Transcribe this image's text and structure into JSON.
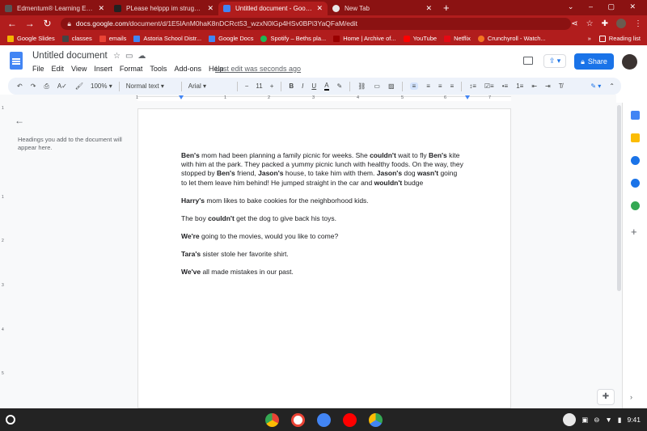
{
  "tabs": [
    {
      "title": "Edmentum® Learning Environme",
      "icon_color": "#555555"
    },
    {
      "title": "PLease helppp im struggling - Br",
      "icon_color": "#222222"
    },
    {
      "title": "Untitled document - Google Docs",
      "icon_color": "#4285f4",
      "active": true
    },
    {
      "title": "New Tab",
      "icon_color": "#e8e8e8"
    }
  ],
  "address": {
    "domain": "docs.google.com",
    "path": "/document/d/1E5lAnM0haK8nDCRct53_wzxN0lGp4HSv0BPi3YaQFaM/edit"
  },
  "bookmarks": [
    {
      "label": "Google Slides",
      "icon_color": "#f4b400"
    },
    {
      "label": "classes",
      "icon_color": "#444444"
    },
    {
      "label": "emails",
      "icon_color": "#ea4335"
    },
    {
      "label": "Astoria School Distr...",
      "icon_color": "#4285f4"
    },
    {
      "label": "Google Docs",
      "icon_color": "#4285f4"
    },
    {
      "label": "Spotify – Beths pla...",
      "icon_color": "#1db954"
    },
    {
      "label": "Home | Archive of...",
      "icon_color": "#990000"
    },
    {
      "label": "YouTube",
      "icon_color": "#ff0000"
    },
    {
      "label": "Netflix",
      "icon_color": "#e50914"
    },
    {
      "label": "Crunchyroll - Watch...",
      "icon_color": "#f47521"
    }
  ],
  "reading_list": "Reading list",
  "docs": {
    "title": "Untitled document",
    "menus": [
      "File",
      "Edit",
      "View",
      "Insert",
      "Format",
      "Tools",
      "Add-ons",
      "Help"
    ],
    "last_edit": "Last edit was seconds ago",
    "share_label": "Share"
  },
  "toolbar": {
    "zoom": "100%",
    "style": "Normal text",
    "font": "Arial",
    "size": "11"
  },
  "ruler_numbers": [
    "1",
    "1",
    "2",
    "3",
    "4",
    "5",
    "6",
    "7"
  ],
  "outline": {
    "hint": "Headings you add to the document will appear here."
  },
  "document": {
    "p1": [
      {
        "t": "Ben's",
        "b": true
      },
      {
        "t": " mom had been planning a family picnic for weeks. She "
      },
      {
        "t": "couldn't",
        "b": true
      },
      {
        "t": " wait to fly "
      },
      {
        "t": "Ben's",
        "b": true
      },
      {
        "t": " kite with him at the park. They packed a yummy picnic lunch with healthy foods. On the way, they stopped by "
      },
      {
        "t": "Ben's",
        "b": true
      },
      {
        "t": " friend, "
      },
      {
        "t": "Jason's",
        "b": true
      },
      {
        "t": " house, to take him with them. "
      },
      {
        "t": "Jason's",
        "b": true
      },
      {
        "t": " dog "
      },
      {
        "t": "wasn't",
        "b": true
      },
      {
        "t": " going to let them leave him behind! He jumped straight in the car and "
      },
      {
        "t": "wouldn't",
        "b": true
      },
      {
        "t": " budge"
      }
    ],
    "p2": [
      {
        "t": "Harry's",
        "b": true
      },
      {
        "t": " mom likes to bake cookies for the neighborhood kids."
      }
    ],
    "p3": [
      {
        "t": "The boy "
      },
      {
        "t": "couldn't",
        "b": true
      },
      {
        "t": " get the dog to give back his toys."
      }
    ],
    "p4": [
      {
        "t": "We're",
        "b": true
      },
      {
        "t": " going to the movies, would you like to come?"
      }
    ],
    "p5": [
      {
        "t": "Tara's",
        "b": true
      },
      {
        "t": " sister stole her favorite shirt."
      }
    ],
    "p6": [
      {
        "t": "We've",
        "b": true
      },
      {
        "t": " all made mistakes in our past."
      }
    ]
  },
  "shelf": {
    "time": "9:41",
    "apps": [
      {
        "name": "chrome-app",
        "color": "#ea4335"
      },
      {
        "name": "gmail-app",
        "color": "#ffffff"
      },
      {
        "name": "docs-app",
        "color": "#4285f4"
      },
      {
        "name": "youtube-app",
        "color": "#ff0000"
      },
      {
        "name": "play-store-app",
        "color": "#34a853"
      }
    ]
  }
}
